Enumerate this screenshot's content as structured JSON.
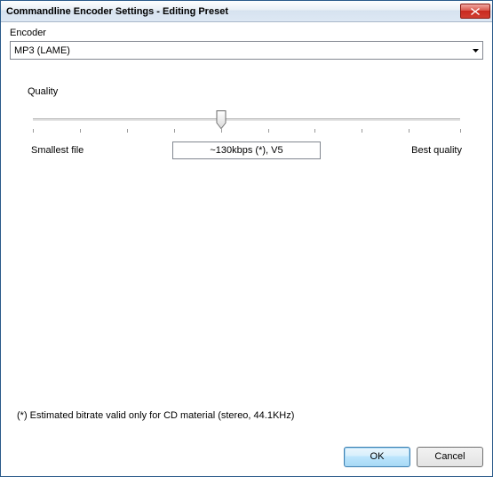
{
  "title": "Commandline Encoder Settings - Editing Preset",
  "encoder": {
    "label": "Encoder",
    "selected": "MP3 (LAME)"
  },
  "quality": {
    "label": "Quality",
    "left_hint": "Smallest file",
    "right_hint": "Best quality",
    "value_text": "~130kbps (*), V5"
  },
  "footnote": "(*) Estimated bitrate valid only for CD material (stereo, 44.1KHz)",
  "buttons": {
    "ok": "OK",
    "cancel": "Cancel"
  }
}
